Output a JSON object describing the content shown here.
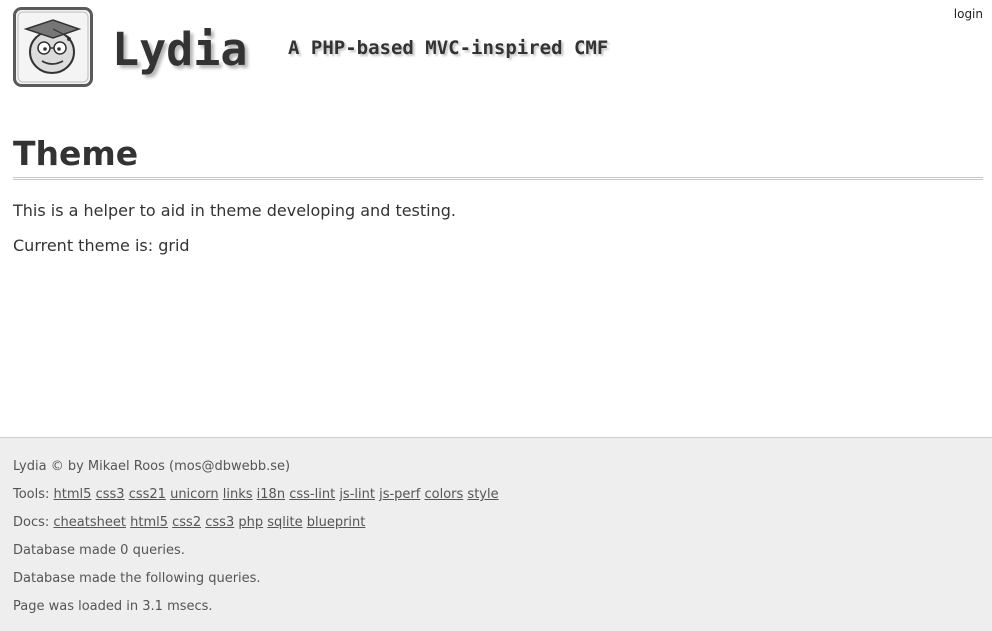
{
  "header": {
    "site_title": "Lydia",
    "site_slogan": "A PHP-based MVC-inspired CMF",
    "login_label": "login",
    "logo_icon": "graduate-face-logo-icon"
  },
  "main": {
    "title": "Theme",
    "paragraph1": "This is a helper to aid in theme developing and testing.",
    "paragraph2": "Current theme is: grid"
  },
  "footer": {
    "copyright": "Lydia © by Mikael Roos (mos@dbwebb.se)",
    "tools_label": "Tools:",
    "tools_links": [
      "html5",
      "css3",
      "css21",
      "unicorn",
      "links",
      "i18n",
      "css-lint",
      "js-lint",
      "js-perf",
      "colors",
      "style"
    ],
    "docs_label": "Docs:",
    "docs_links": [
      "cheatsheet",
      "html5",
      "css2",
      "css3",
      "php",
      "sqlite",
      "blueprint"
    ],
    "db_queries_count": "Database made 0 queries.",
    "db_queries_list": "Database made the following queries.",
    "load_time": "Page was loaded in 3.1 msecs."
  }
}
